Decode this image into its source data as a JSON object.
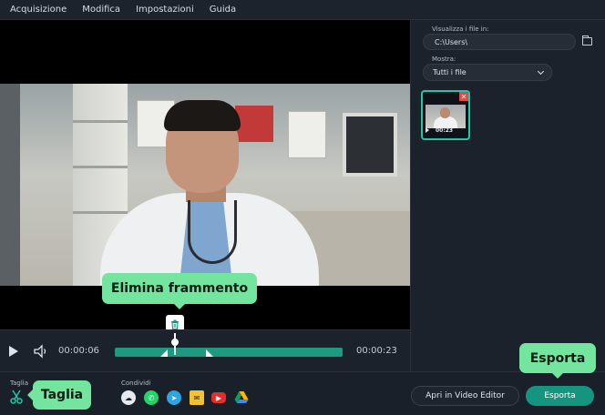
{
  "menu": [
    "Acquisizione",
    "Modifica",
    "Impostazioni",
    "Guida"
  ],
  "player": {
    "current_time": "00:00:06",
    "total_time": "00:00:23",
    "progress_fraction": 0.26
  },
  "tooltips": {
    "delete_fragment": "Elimina frammento",
    "export": "Esporta",
    "trim": "Taglia"
  },
  "bottom": {
    "trim_section_label": "Taglia",
    "share_section_label": "Condividi",
    "share_services": [
      "cloud-upload-icon",
      "whatsapp-icon",
      "telegram-icon",
      "email-icon",
      "youtube-icon",
      "google-drive-icon"
    ],
    "open_editor_label": "Apri in Video Editor",
    "export_label": "Esporta"
  },
  "panel": {
    "show_files_in_label": "Visualizza i file in:",
    "path_value": "C:\\Users\\",
    "show_label": "Mostra:",
    "filter_value": "Tutti i file",
    "thumbnail_duration": "00:23"
  },
  "colors": {
    "accent": "#15957f",
    "tooltip": "#74e59f",
    "selection": "#1fc9a8",
    "delete": "#e04a4a"
  }
}
